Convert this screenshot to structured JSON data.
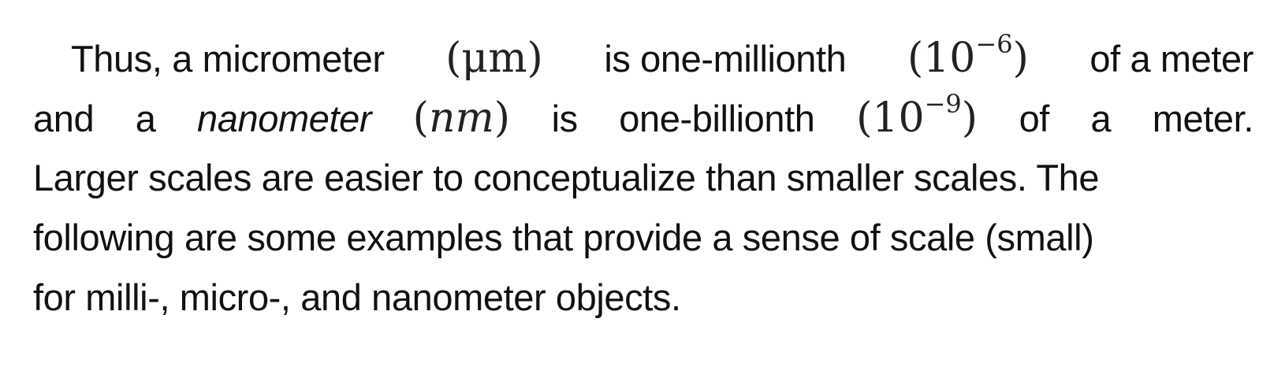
{
  "paragraph": {
    "line1": {
      "t1": "Thus, a micrometer",
      "m1": "(μm)",
      "t2": "is one-millionth",
      "m2_open": "(10",
      "m2_exp": "−6",
      "m2_close": ")",
      "t3": "of a meter"
    },
    "line2": {
      "t1": "and",
      "t2": "a",
      "em": "nanometer",
      "m1_open": "(",
      "m1_var": "nm",
      "m1_close": ")",
      "t3": "is",
      "t4": "one-billionth",
      "m2_open": "(10",
      "m2_exp": "−9",
      "m2_close": ")",
      "t5": "of",
      "t6": "a",
      "t7": "meter."
    },
    "line3": "Larger scales are easier to conceptualize than smaller scales. The",
    "line4": "following are some examples that provide a sense of scale (small)",
    "line5": "for milli-, micro-, and nanometer objects."
  }
}
